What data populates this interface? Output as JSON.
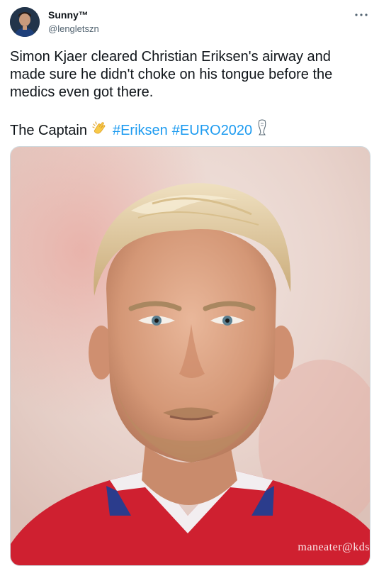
{
  "user": {
    "display_name": "Sunny™",
    "handle": "@lengletszn",
    "avatar_icon": "user-avatar-icon"
  },
  "menu": {
    "icon": "more-horizontal-icon"
  },
  "tweet": {
    "text_line1": "Simon Kjaer cleared Christian Eriksen's airway and made sure he didn't choke on his tongue before the medics even got there.",
    "text_prefix": "The Captain",
    "emoji_clap": "clapping-hands-emoji",
    "hashtags": [
      "#Eriksen",
      "#EURO2020"
    ],
    "emoji_trophy": "trophy-emoji"
  },
  "media": {
    "watermark": "maneater@kds",
    "description_icon": "portrait-photo"
  },
  "colors": {
    "hashtag": "#1d9bf0",
    "text": "#0f1419",
    "secondary": "#536471",
    "border": "#cfd9de"
  }
}
